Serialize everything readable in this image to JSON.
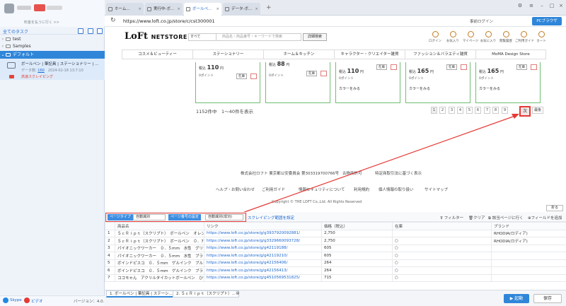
{
  "sidebar": {
    "upgrade": "料金を払うに行く >>",
    "all_tasks": "全てのタスク",
    "tree": [
      {
        "label": "test"
      },
      {
        "label": "Samples"
      },
      {
        "label": "デフォルト"
      }
    ],
    "task": {
      "title": "ボールペン | 筆記具 | ステーショナリー | ...",
      "count_label": "データ数",
      "count": "160",
      "timestamp": "2024-02-18 13:7:10",
      "mode": "高速スクレイピング"
    },
    "footer": {
      "skype": "Skype",
      "video": "ビデオ",
      "version": "バージョン：4.0.1"
    }
  },
  "browser": {
    "tabs": [
      {
        "label": "ホーム..."
      },
      {
        "label": "実行中-ボ..."
      },
      {
        "label": "ボールペ..."
      },
      {
        "label": "データ-ボ..."
      }
    ],
    "url": "https://www.loft.co.jp/store/c/cst300001",
    "login": "事前ログイン",
    "pc_browser": "PCブラウザ"
  },
  "site": {
    "logo_main": "LoFt",
    "logo_sub": "NETSTORE",
    "category_select": "すべて",
    "search_placeholder": "商品名・商品番号・キーワードで検索",
    "search_button": "詳細検索",
    "header_icons": [
      {
        "label": "ログイン",
        "icon": "login-icon"
      },
      {
        "label": "お気入り",
        "icon": "heart-icon"
      },
      {
        "label": "マイページ",
        "icon": "user-icon"
      },
      {
        "label": "お気に入り",
        "icon": "star-icon"
      },
      {
        "label": "閲覧履歴",
        "icon": "history-icon"
      },
      {
        "label": "ご利用ガイド",
        "icon": "guide-icon"
      },
      {
        "label": "カート",
        "icon": "cart-icon"
      }
    ],
    "nav": [
      "コスメ＆ビューティー",
      "ステーショナリー",
      "ホーム＆キッチン",
      "キャラクター・クリエイター雑貨",
      "ファッション＆バラエティ雑貨",
      "MoMA Design Store"
    ],
    "cards": [
      {
        "price": "110",
        "price_prefix": "税込",
        "unit": "円",
        "points": "0ポイント",
        "stock": "在庫",
        "color_btn": ""
      },
      {
        "price": "88",
        "price_prefix": "税込",
        "unit": "円",
        "points": "0ポイント",
        "stock": "在庫",
        "color_btn": ""
      },
      {
        "price": "110",
        "price_prefix": "税込",
        "unit": "円",
        "points": "0ポイント",
        "stock": "在庫",
        "color_btn": "カラーをみる"
      },
      {
        "price": "165",
        "price_prefix": "税込",
        "unit": "円",
        "points": "0ポイント",
        "stock": "在庫",
        "color_btn": "カラーをみる"
      },
      {
        "price": "165",
        "price_prefix": "税込",
        "unit": "円",
        "points": "0ポイント",
        "stock": "在庫",
        "color_btn": "カラーをみる"
      }
    ],
    "result_count": "1152件中　1〜40件を表示",
    "pages": [
      "1",
      "2",
      "3",
      "4",
      "5",
      "6",
      "7",
      "8",
      "9"
    ],
    "next": "次",
    "last": "最後",
    "company": "株式会社ロフト 東京都公安委員会 第303319700766号",
    "permit": "古物商許可",
    "permit2": "特定商取引法に基づく表示",
    "footer_links": [
      "ヘルプ・お問い合わせ",
      "ご利用ガイド",
      "情報セキュリティについて",
      "利用規約",
      "個人情報の取り扱い",
      "サイトマップ"
    ],
    "copyright": "Copyright © THE LOFT Co.,Ltd. All Rights Reserved"
  },
  "panel": {
    "collapse": "折る",
    "page_type_label": "ページタイプ",
    "page_type_value": "自動識別",
    "page_count_label": "ページ番号の設定",
    "page_count_value": "自動識別(成功)",
    "scroll_setting": "スクレイピング範囲を設定",
    "filter": "フィルター",
    "clear": "クリア",
    "goto_page": "該当ページに行く",
    "add_field": "フィールドを追加",
    "columns": [
      "商品名",
      "リンク",
      "価格（税込）",
      "在庫",
      "ブランド"
    ],
    "rows": [
      {
        "n": "1",
        "name": "ＳｃＲｉｐｔ（スクリプト）　ボールペン　オレン...",
        "link": "https://www.loft.co.jp/store/g/g3937920092881/",
        "price": "2,750",
        "stock": "",
        "brand": "RHODIA(ロディア)"
      },
      {
        "n": "2",
        "name": "ＳｃＲｉｐｔ（スクリプト）　ボールペン　０．7...",
        "link": "https://www.loft.co.jp/store/g/g3329660093728/",
        "price": "2,750",
        "stock": "○",
        "brand": "RHODIA(ロディア)"
      },
      {
        "n": "3",
        "name": "パイオニックワーカー　０．５ｍｍ　水性　グリーン",
        "link": "https://www.loft.co.jp/store/g/g42119188/",
        "price": "605",
        "stock": "○",
        "brand": ""
      },
      {
        "n": "4",
        "name": "パイオニックワーカー　０．５ｍｍ　水性　ブラック",
        "link": "https://www.loft.co.jp/store/g/g42119210/",
        "price": "605",
        "stock": "○",
        "brand": ""
      },
      {
        "n": "5",
        "name": "ボインドピスコ　０．５ｍｍ　ゲルインク　ブルー",
        "link": "https://www.loft.co.jp/store/g/g42156406/",
        "price": "264",
        "stock": "○",
        "brand": ""
      },
      {
        "n": "6",
        "name": "ボインドピスコ　０．５ｍｍ　ゲルインク　ブラック",
        "link": "https://www.loft.co.jp/store/g/g42156413/",
        "price": "264",
        "stock": "○",
        "brand": ""
      },
      {
        "n": "7",
        "name": "ココモゃん　アクリルタイカットボールペン　ひつ...",
        "link": "https://www.loft.co.jp/store/g/g4510569531825/",
        "price": "715",
        "stock": "○",
        "brand": ""
      }
    ]
  },
  "bottom": {
    "tabs": [
      "1. ボールペン | 筆記具 | ステーシ...",
      "2. ＳｃＲｉｐｔ（スクリプト）..."
    ],
    "start": "起動",
    "save": "保存"
  },
  "colors": {
    "accent": "#2f86d9",
    "highlight": "#e53935"
  }
}
